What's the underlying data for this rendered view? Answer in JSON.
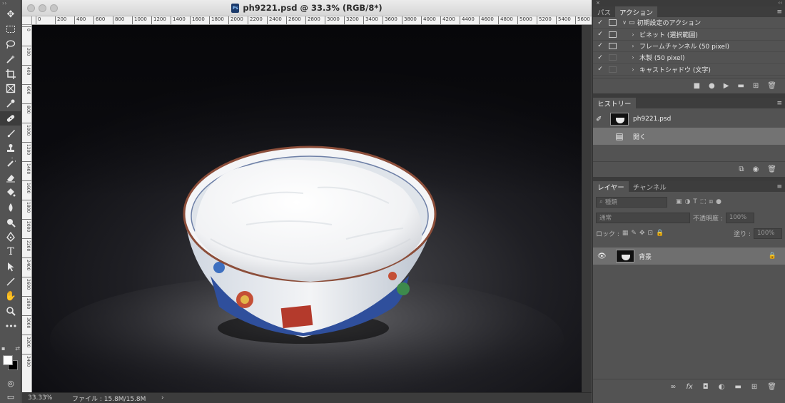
{
  "document": {
    "title": "ph9221.psd @ 33.3% (RGB/8*)",
    "psd_badge": "Ps",
    "ruler_h": [
      "0",
      "200",
      "400",
      "600",
      "800",
      "1000",
      "1200",
      "1400",
      "1600",
      "1800",
      "2000",
      "2200",
      "2400",
      "2600",
      "2800",
      "3000",
      "3200",
      "3400",
      "3600",
      "3800",
      "4000",
      "4200",
      "4400",
      "4600",
      "4800",
      "5000",
      "5200",
      "5400",
      "5600"
    ],
    "ruler_v": [
      "0",
      "200",
      "400",
      "600",
      "800",
      "1000",
      "1200",
      "1400",
      "1600",
      "1800",
      "2000",
      "2200",
      "2400",
      "2600",
      "2800",
      "3000",
      "3200",
      "3400"
    ]
  },
  "status": {
    "zoom": "33.33%",
    "file_info": "ファイル : 15.8M/15.8M",
    "arrow": "›"
  },
  "panels": {
    "top_tabs": {
      "paths": "パス",
      "actions": "アクション"
    },
    "actions": [
      {
        "label": "初期設定のアクション",
        "dialog_on": true,
        "folder": true,
        "arrow": "∨"
      },
      {
        "label": "ビネット (選択範囲)",
        "dialog_on": true,
        "arrow": "›"
      },
      {
        "label": "フレームチャンネル (50 pixel)",
        "dialog_on": true,
        "arrow": "›"
      },
      {
        "label": "木製 (50 pixel)",
        "dialog_on": false,
        "arrow": "›"
      },
      {
        "label": "キャストシャドウ (文字)",
        "dialog_on": false,
        "arrow": "›"
      }
    ],
    "history_tab": "ヒストリー",
    "history": [
      {
        "label": "ph9221.psd",
        "type": "snapshot"
      },
      {
        "label": "開く",
        "type": "step"
      }
    ],
    "layer_tabs": {
      "layers": "レイヤー",
      "channels": "チャンネル"
    },
    "layers": {
      "filter_placeholder": "種類",
      "blend_mode": "通常",
      "opacity_label": "不透明度 :",
      "opacity_value": "100%",
      "lock_label": "ロック :",
      "fill_label": "塗り :",
      "fill_value": "100%",
      "items": [
        {
          "name": "背景"
        }
      ]
    }
  }
}
